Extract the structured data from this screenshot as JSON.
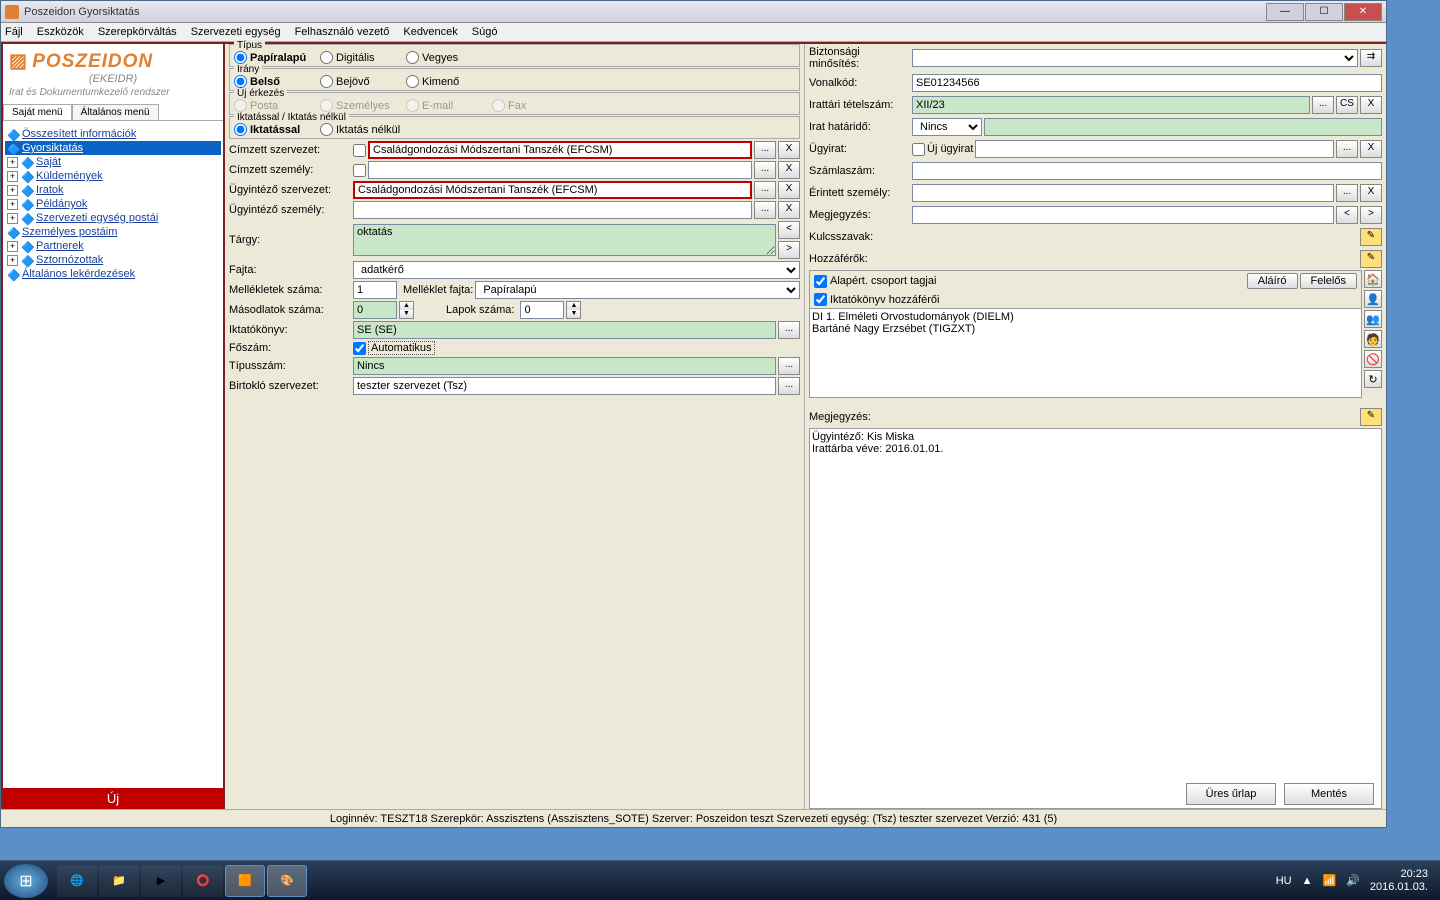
{
  "window": {
    "title": "Poszeidon Gyorsiktatás"
  },
  "menu": [
    "Fájl",
    "Eszközök",
    "Szerepkörváltás",
    "Szervezeti egység",
    "Felhasználó vezető",
    "Kedvencek",
    "Súgó"
  ],
  "logo": {
    "brand": "POSZEIDON",
    "brand2": "(EKEIDR)",
    "sub": "Irat és Dokumentumkezelő rendszer"
  },
  "menutabs": {
    "t1": "Saját menü",
    "t2": "Általános menü"
  },
  "tree": [
    {
      "label": "Összesített információk"
    },
    {
      "label": "Gyorsiktatás",
      "sel": true
    },
    {
      "label": "Saját"
    },
    {
      "label": "Küldemények"
    },
    {
      "label": "Iratok"
    },
    {
      "label": "Példányok"
    },
    {
      "label": "Szervezeti egység postái"
    },
    {
      "label": "Személyes postáim"
    },
    {
      "label": "Partnerek"
    },
    {
      "label": "Sztornózottak"
    },
    {
      "label": "Általános lekérdezések"
    }
  ],
  "newbtn": "Új",
  "grp": {
    "tipus": {
      "title": "Típus",
      "o1": "Papíralapú",
      "o2": "Digitális",
      "o3": "Vegyes"
    },
    "irany": {
      "title": "Irány",
      "o1": "Belső",
      "o2": "Bejövő",
      "o3": "Kimenő"
    },
    "erk": {
      "title": "Új érkezés",
      "o1": "Posta",
      "o2": "Személyes",
      "o3": "E-mail",
      "o4": "Fax"
    },
    "ikt": {
      "title": "Iktatással / Iktatás nélkül",
      "o1": "Iktatással",
      "o2": "Iktatás nélkül"
    }
  },
  "labels": {
    "cimzett_szerv": "Címzett szervezet:",
    "cimzett_szem": "Címzett személy:",
    "ugyint_szerv": "Ügyintéző szervezet:",
    "ugyint_szem": "Ügyintéző személy:",
    "targy": "Tárgy:",
    "fajta": "Fajta:",
    "mellsz": "Mellékletek száma:",
    "mellfajta": "Melléklet fajta:",
    "masod": "Másodlatok száma:",
    "lapok": "Lapok száma:",
    "iktkv": "Iktatókönyv:",
    "foszam": "Főszám:",
    "auto": "Automatikus",
    "tipusz": "Típusszám:",
    "birtsz": "Birtokló szervezet:",
    "bizmin": "Biztonsági minősítés:",
    "vonalk": "Vonalkód:",
    "irtet": "Irattári tételszám:",
    "cs": "CS",
    "irhat": "Irat határidő:",
    "ugyir": "Ügyirat:",
    "ujugy": "Új ügyirat",
    "szamla": "Számlaszám:",
    "erint": "Érintett személy:",
    "megj": "Megjegyzés:",
    "kulcs": "Kulcsszavak:",
    "hozza": "Hozzáférők:",
    "alap": "Alapért. csoport tagjai",
    "iktkh": "Iktatókönyv hozzáférői",
    "alairo": "Aláíró",
    "felelos": "Felelős",
    "megj2": "Megjegyzés:"
  },
  "values": {
    "cimzett_szerv": "Családgondozási Módszertani Tanszék (EFCSM)",
    "ugyint_szerv": "Családgondozási Módszertani Tanszék (EFCSM)",
    "targy": "oktatás",
    "fajta": "adatkérő",
    "mellsz": "1",
    "mellfajta": "Papíralapú",
    "masod": "0",
    "lapok": "0",
    "iktkv": "SE (SE)",
    "tipusz": "Nincs",
    "birtsz": "teszter szervezet (Tsz)",
    "vonalk": "SE01234566",
    "irtet": "XII/23",
    "irhat": "Nincs",
    "access": [
      "DI 1. Elméleti Orvostudományok  (DIELM)",
      "Bartáné Nagy Erzsébet (TIGZXT)"
    ],
    "note": "Ügyintéző: Kis Miska\nIrattárba véve: 2016.01.01."
  },
  "bottom": {
    "ures": "Üres űrlap",
    "mentes": "Mentés"
  },
  "status": "Loginnév: TESZT18   Szerepkör: Asszisztens (Asszisztens_SOTE)   Szerver: Poszeidon teszt   Szervezeti egység: (Tsz) teszter szervezet   Verzió: 431 (5)",
  "taskbar": {
    "lang": "HU",
    "time": "20:23",
    "date": "2016.01.03."
  }
}
